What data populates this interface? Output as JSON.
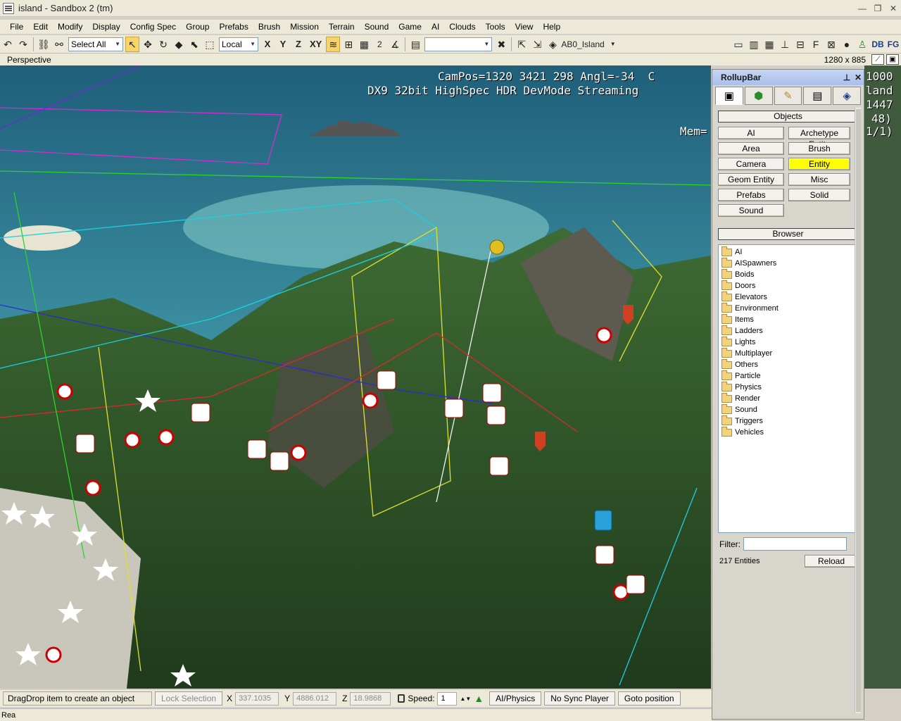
{
  "window": {
    "title": "island - Sandbox 2 (tm)",
    "min": "—",
    "max": "❐",
    "close": "✕"
  },
  "menu": [
    "File",
    "Edit",
    "Modify",
    "Display",
    "Config Spec",
    "Group",
    "Prefabs",
    "Brush",
    "Mission",
    "Terrain",
    "Sound",
    "Game",
    "AI",
    "Clouds",
    "Tools",
    "View",
    "Help"
  ],
  "toolbar": {
    "select_filter": "Select All",
    "coord_system": "Local",
    "axes": [
      "X",
      "Y",
      "Z",
      "XY"
    ],
    "grid_value": "2",
    "layer_combo": "",
    "layer_name": "AB0_Island"
  },
  "toolbar_right": {
    "db_label": "DB",
    "fg_label": "FG"
  },
  "viewport": {
    "title": "Perspective",
    "size": "1280 x 885",
    "hud_line1": "CamPos=1320 3421 298 Angl=-34  C",
    "hud_line1_right": "1000",
    "hud_line2": "DX9 32bit HighSpec HDR DevMode Streaming",
    "hud_line2_right": "land",
    "hud_line3_right": "1447",
    "hud_line4_right": "48)",
    "hud_line5": "Mem=",
    "hud_line5_right": "1/1)"
  },
  "rollup": {
    "title": "RollupBar",
    "pin": "📌",
    "close": "✕",
    "tabs": [
      {
        "icon": "create-icon",
        "glyph": "▣"
      },
      {
        "icon": "terrain-icon",
        "glyph": "⬢"
      },
      {
        "icon": "modify-icon",
        "glyph": "✎"
      },
      {
        "icon": "display-icon",
        "glyph": "▤"
      },
      {
        "icon": "layers-icon",
        "glyph": "◈"
      }
    ],
    "objects_label": "Objects",
    "object_buttons": [
      {
        "label": "AI",
        "selected": false
      },
      {
        "label": "Archetype Entity",
        "selected": false
      },
      {
        "label": "Area",
        "selected": false
      },
      {
        "label": "Brush",
        "selected": false
      },
      {
        "label": "Camera",
        "selected": false
      },
      {
        "label": "Entity",
        "selected": true
      },
      {
        "label": "Geom Entity",
        "selected": false
      },
      {
        "label": "Misc",
        "selected": false
      },
      {
        "label": "Prefabs",
        "selected": false
      },
      {
        "label": "Solid",
        "selected": false
      },
      {
        "label": "Sound",
        "selected": false
      }
    ],
    "browser_label": "Browser",
    "folders": [
      "AI",
      "AISpawners",
      "Boids",
      "Doors",
      "Elevators",
      "Environment",
      "Items",
      "Ladders",
      "Lights",
      "Multiplayer",
      "Others",
      "Particle",
      "Physics",
      "Render",
      "Sound",
      "Triggers",
      "Vehicles"
    ],
    "filter_label": "Filter:",
    "filter_value": "",
    "entity_count": "217 Entities",
    "reload_label": "Reload"
  },
  "status": {
    "hint": "DragDrop item to create an object",
    "lock_selection": "Lock Selection",
    "x_label": "X",
    "x_value": "337.1035",
    "y_label": "Y",
    "y_value": "4886.012",
    "z_label": "Z",
    "z_value": "18.9868",
    "speed_label": "Speed:",
    "speed_value": "1",
    "ai_physics": "AI/Physics",
    "no_sync": "No Sync Player",
    "goto": "Goto position",
    "bottom_left": "Rea"
  }
}
